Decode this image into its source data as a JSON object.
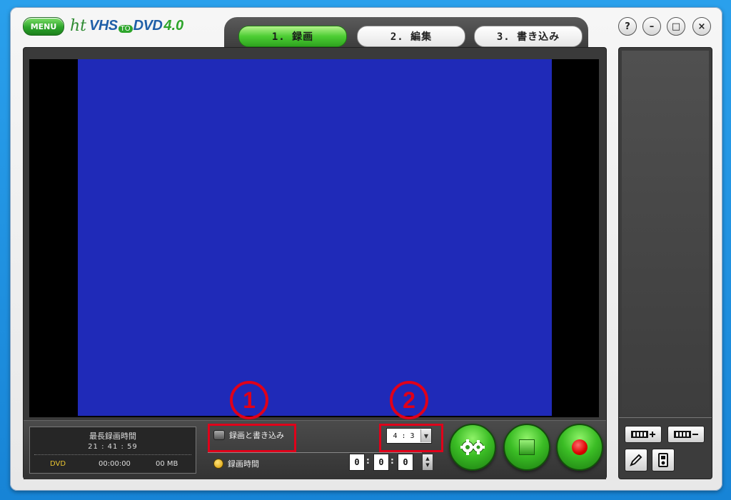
{
  "window": {
    "menu_label": "MENU",
    "logo": {
      "ht": "ht",
      "vhs": "VHS",
      "to": "TO",
      "dvd": "DVD",
      "version": "4.0"
    },
    "tabs": [
      {
        "label": "1. 録画",
        "active": true
      },
      {
        "label": "2. 編集",
        "active": false
      },
      {
        "label": "3. 書き込み",
        "active": false
      }
    ],
    "controls": {
      "help": "?",
      "minimize": "–",
      "maximize": "□",
      "close": "×"
    }
  },
  "info": {
    "title": "最長録画時間",
    "max_time": "21 : 41 : 59",
    "disc_type": "DVD",
    "duration": "00:00:00",
    "size": "00 MB"
  },
  "options": {
    "record_and_burn_label": "録画と書き込み",
    "record_time_label": "録画時間",
    "aspect_ratio": "4 : 3",
    "time_hours": "0",
    "time_minutes": "0",
    "time_seconds": "0"
  },
  "annotations": {
    "marker1": "1",
    "marker2": "2"
  },
  "colors": {
    "accent_green": "#3bbd25",
    "highlight_red": "#e0001a",
    "video_blue": "#1f2ab8"
  },
  "icons": {
    "settings": "gear-icon",
    "stop": "stop-icon",
    "record": "record-icon",
    "add_clip": "film-plus-icon",
    "remove_clip": "film-minus-icon",
    "edit": "pencil-icon",
    "device": "device-icon"
  }
}
